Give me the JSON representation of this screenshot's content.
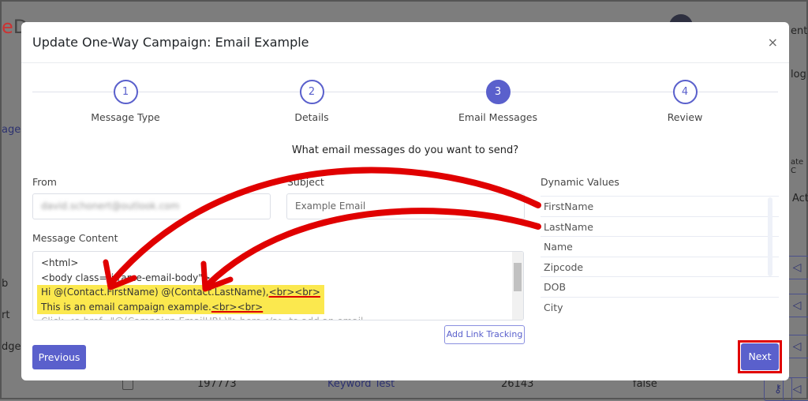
{
  "background": {
    "logo_fragment": "D",
    "header_right": "entat",
    "side_texts": [
      "ages",
      "b",
      "rt",
      "dge"
    ],
    "right_texts": [
      "log",
      "ate C",
      "Act"
    ],
    "row": {
      "id": "197773",
      "name": "Keyword Test",
      "number": "26143",
      "flag": "false"
    }
  },
  "modal": {
    "title": "Update One-Way Campaign: Email Example",
    "close": "×",
    "steps": [
      {
        "num": "1",
        "label": "Message Type"
      },
      {
        "num": "2",
        "label": "Details"
      },
      {
        "num": "3",
        "label": "Email Messages",
        "active": true
      },
      {
        "num": "4",
        "label": "Review"
      }
    ],
    "question": "What email messages do you want to send?",
    "from_label": "From",
    "from_value": "david.schonert@outlook.com",
    "subject_label": "Subject",
    "subject_value": "Example Email",
    "message_label": "Message Content",
    "message_lines": [
      "<html>",
      "<body class=\"iframe-email-body\">",
      "Hi @(Contact.FirstName) @(Contact.LastName),",
      "<br><br>",
      "This is an email campaign example.",
      "<br><br>",
      "Click <a href=\"@(Campaign.EmailURL)\">here</a> to add an email"
    ],
    "add_link_tracking": "Add Link Tracking",
    "dynamic_label": "Dynamic Values",
    "dynamic_values": [
      "FirstName",
      "LastName",
      "Name",
      "Zipcode",
      "DOB",
      "City"
    ],
    "previous": "Previous",
    "next": "Next"
  },
  "colors": {
    "accent": "#5a60cc",
    "highlight": "#fbe84e",
    "annotation": "#e00000"
  }
}
